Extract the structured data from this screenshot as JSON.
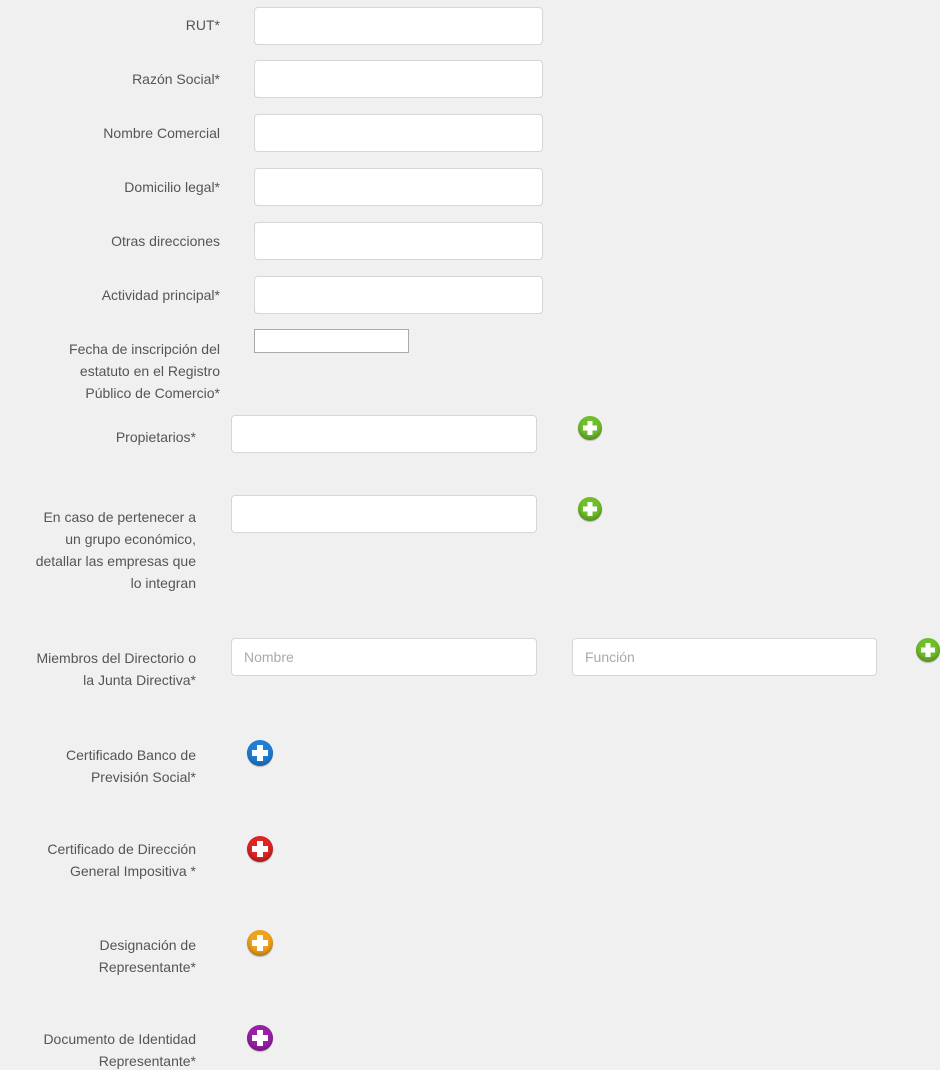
{
  "form": {
    "fields": {
      "rut": {
        "label": "RUT*",
        "value": ""
      },
      "razon_social": {
        "label": "Razón Social*",
        "value": ""
      },
      "nombre_comercial": {
        "label": "Nombre Comercial",
        "value": ""
      },
      "domicilio_legal": {
        "label": "Domicilio legal*",
        "value": ""
      },
      "otras_direcciones": {
        "label": "Otras direcciones",
        "value": ""
      },
      "actividad_principal": {
        "label": "Actividad principal*",
        "value": ""
      },
      "fecha_inscripcion": {
        "label_lines": [
          "Fecha de inscripción del",
          "estatuto en el Registro",
          "Público de Comercio*"
        ],
        "value": ""
      },
      "propietarios": {
        "label": "Propietarios*",
        "value": ""
      },
      "grupo_economico": {
        "label_lines": [
          "En caso de pertenecer a",
          "un grupo económico,",
          "detallar las empresas que",
          "lo integran"
        ],
        "value": ""
      },
      "miembros_directorio": {
        "label_lines": [
          "Miembros del Directorio o",
          "la Junta Directiva*"
        ],
        "nombre_placeholder": "Nombre",
        "funcion_placeholder": "Función"
      }
    },
    "uploads": {
      "certificado_bps": {
        "label_lines": [
          "Certificado Banco de",
          "Previsión Social*"
        ]
      },
      "certificado_dgi": {
        "label_lines": [
          "Certificado de Dirección",
          "General Impositiva *"
        ]
      },
      "designacion_representante": {
        "label_lines": [
          "Designación de",
          "Representante*"
        ]
      },
      "documento_identidad": {
        "label_lines": [
          "Documento de Identidad",
          "Representante*"
        ]
      }
    }
  },
  "icons": {
    "add_green": {
      "name": "plus-circle-icon",
      "color": "#6fbf2a"
    },
    "add_blue": {
      "name": "plus-circle-icon",
      "color": "#1f7fd6"
    },
    "add_red": {
      "name": "plus-circle-icon",
      "color": "#e02424"
    },
    "add_orange": {
      "name": "plus-circle-icon",
      "color": "#f0a31a"
    },
    "add_purple": {
      "name": "plus-circle-icon",
      "color": "#9a1fa8"
    }
  }
}
